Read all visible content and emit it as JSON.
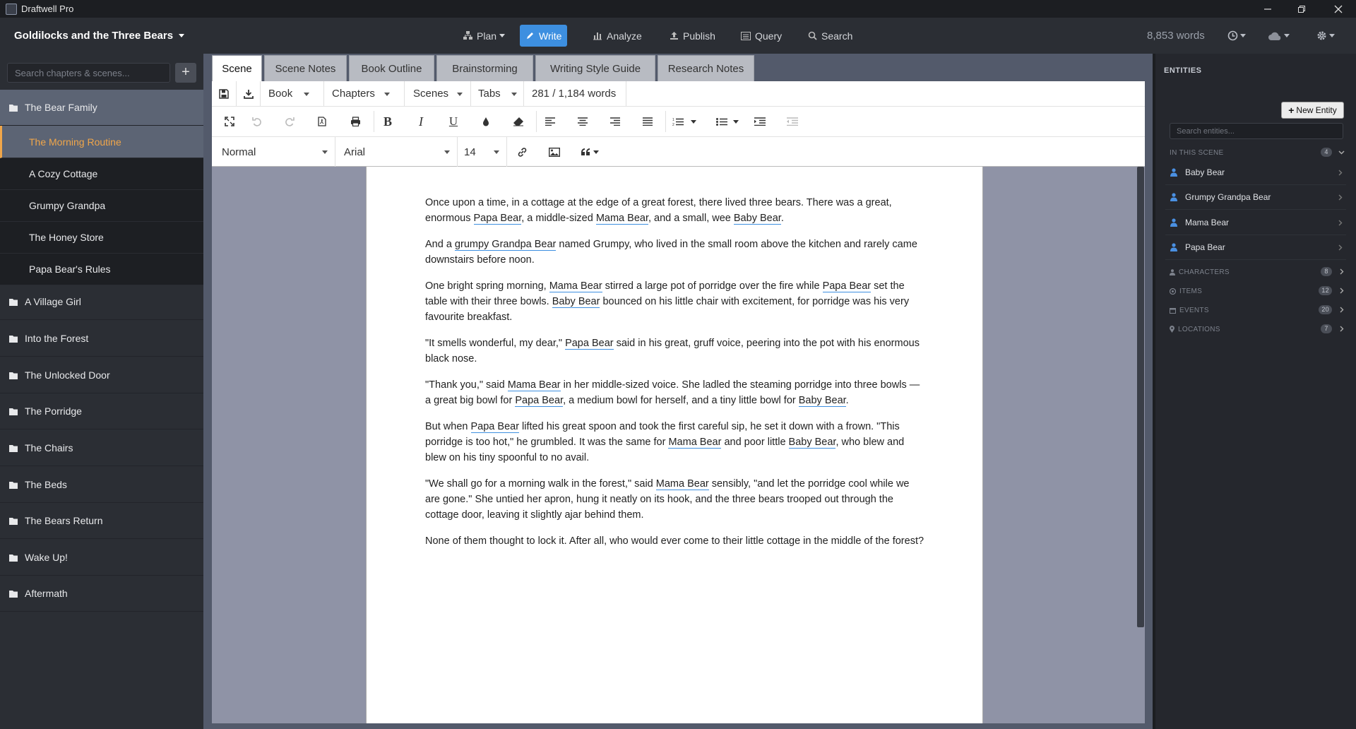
{
  "app": {
    "title": "Draftwell Pro"
  },
  "book": {
    "title": "Goldilocks and the Three Bears"
  },
  "menu": {
    "plan": "Plan",
    "write": "Write",
    "analyze": "Analyze",
    "publish": "Publish",
    "query": "Query",
    "search": "Search"
  },
  "word_count": "8,853 words",
  "sidebar": {
    "search_placeholder": "Search chapters & scenes...",
    "chapters": [
      {
        "title": "The Bear Family",
        "open": true,
        "scenes": [
          "The Morning Routine",
          "A Cozy Cottage",
          "Grumpy Grandpa",
          "The Honey Store",
          "Papa Bear's Rules"
        ]
      },
      {
        "title": "A Village Girl"
      },
      {
        "title": "Into the Forest"
      },
      {
        "title": "The Unlocked Door"
      },
      {
        "title": "The Porridge"
      },
      {
        "title": "The Chairs"
      },
      {
        "title": "The Beds"
      },
      {
        "title": "The Bears Return"
      },
      {
        "title": "Wake Up!"
      },
      {
        "title": "Aftermath"
      }
    ],
    "active_scene": "The Morning Routine"
  },
  "tabs": [
    "Scene",
    "Scene Notes",
    "Book Outline",
    "Brainstorming",
    "Writing Style Guide",
    "Research Notes"
  ],
  "active_tab": "Scene",
  "toolbar": {
    "book": "Book",
    "chapters": "Chapters",
    "scenes": "Scenes",
    "tabs": "Tabs",
    "word_progress": "281 / 1,184 words",
    "paragraph_style": "Normal",
    "font": "Arial",
    "font_size": "14"
  },
  "editor": {
    "paragraphs": [
      [
        {
          "t": "Once upon a time, in a cottage at the edge of a great forest, there lived three bears. There was a great, enormous "
        },
        {
          "e": "Papa Bear"
        },
        {
          "t": ", a middle-sized "
        },
        {
          "e": "Mama Bear"
        },
        {
          "t": ", and a small, wee "
        },
        {
          "e": "Baby Bear"
        },
        {
          "t": "."
        }
      ],
      [
        {
          "t": "And a "
        },
        {
          "e": "grumpy Grandpa Bear"
        },
        {
          "t": " named Grumpy, who lived in the small room above the kitchen and rarely came downstairs before noon."
        }
      ],
      [
        {
          "t": "One bright spring morning, "
        },
        {
          "e": "Mama Bear"
        },
        {
          "t": " stirred a large pot of porridge over the fire while "
        },
        {
          "e": "Papa Bear"
        },
        {
          "t": " set the table with their three bowls. "
        },
        {
          "e": "Baby Bear"
        },
        {
          "t": " bounced on his little chair with excitement, for porridge was his very favourite breakfast."
        }
      ],
      [
        {
          "t": "\"It smells wonderful, my dear,\" "
        },
        {
          "e": "Papa Bear"
        },
        {
          "t": " said in his great, gruff voice, peering into the pot with his enormous black nose."
        }
      ],
      [
        {
          "t": "\"Thank you,\" said "
        },
        {
          "e": "Mama Bear"
        },
        {
          "t": " in her middle-sized voice. She ladled the steaming porridge into three bowls — a great big bowl for "
        },
        {
          "e": "Papa Bear"
        },
        {
          "t": ", a medium bowl for herself, and a tiny little bowl for "
        },
        {
          "e": "Baby Bear"
        },
        {
          "t": "."
        }
      ],
      [
        {
          "t": "But when "
        },
        {
          "e": "Papa Bear"
        },
        {
          "t": " lifted his great spoon and took the first careful sip, he set it down with a frown. \"This porridge is too hot,\" he grumbled. It was the same for "
        },
        {
          "e": "Mama Bear"
        },
        {
          "t": " and poor little "
        },
        {
          "e": "Baby Bear"
        },
        {
          "t": ", who blew and blew on his tiny spoonful to no avail."
        }
      ],
      [
        {
          "t": "\"We shall go for a morning walk in the forest,\" said "
        },
        {
          "e": "Mama Bear"
        },
        {
          "t": " sensibly, \"and let the porridge cool while we are gone.\" She untied her apron, hung it neatly on its hook, and the three bears trooped out through the cottage door, leaving it slightly ajar behind them."
        }
      ],
      [
        {
          "t": "None of them thought to lock it. After all, who would ever come to their little cottage in the middle of the forest?"
        }
      ]
    ]
  },
  "entities": {
    "header": "ENTITIES",
    "new_button": "New Entity",
    "search_placeholder": "Search entities...",
    "in_scene": {
      "label": "IN THIS SCENE",
      "count": "4",
      "items": [
        "Baby Bear",
        "Grumpy Grandpa Bear",
        "Mama Bear",
        "Papa Bear"
      ]
    },
    "sections": [
      {
        "label": "CHARACTERS",
        "count": "8",
        "icon": "person-icon"
      },
      {
        "label": "ITEMS",
        "count": "12",
        "icon": "tag-icon"
      },
      {
        "label": "EVENTS",
        "count": "20",
        "icon": "calendar-icon"
      },
      {
        "label": "LOCATIONS",
        "count": "7",
        "icon": "map-pin-icon"
      }
    ]
  },
  "colors": {
    "accent": "#3d8fe0",
    "active_scene": "#f0a64a"
  }
}
